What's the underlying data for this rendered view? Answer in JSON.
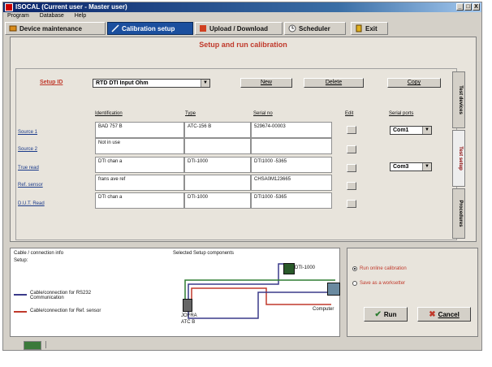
{
  "window": {
    "title": "ISOCAL (Current user - Master user)",
    "buttons": [
      "_",
      "□",
      "X"
    ]
  },
  "menu": [
    "Program",
    "Database",
    "Help"
  ],
  "toolbar": [
    {
      "label": "Device maintenance",
      "icon": "device-icon"
    },
    {
      "label": "Calibration setup",
      "icon": "setup-icon",
      "active": true
    },
    {
      "label": "Upload / Download",
      "icon": "upload-download-icon"
    },
    {
      "label": "Scheduler",
      "icon": "clock-icon"
    },
    {
      "label": "Exit",
      "icon": "exit-icon"
    }
  ],
  "main": {
    "heading": "Setup and run calibration",
    "setup_label": "Setup ID",
    "setup_value": "RTD DTI Input Ohm",
    "buttons": {
      "new": "New",
      "delete": "Delete",
      "copy": "Copy"
    },
    "columns": {
      "identification": "Identification",
      "type": "Type",
      "serial": "Serial no",
      "edit": "Edit",
      "serial_ports": "Serial ports"
    },
    "rows": [
      {
        "label": "Source 1",
        "id": "BAD 757 B",
        "type": "ATC-156 B",
        "serial": "529674-00003",
        "port": "Com1"
      },
      {
        "label": "Source 2",
        "id": "Not in use",
        "type": "",
        "serial": "",
        "port": ""
      },
      {
        "label": "True read",
        "id": "DTI chan a",
        "type": "DTI-1000",
        "serial": "DTI1000 -5365",
        "port": "Com3"
      },
      {
        "label": "Ref. sensor",
        "id": "frans ave ref",
        "type": "",
        "serial": "CHSA0M123665",
        "port": ""
      },
      {
        "label": "D.U.T. Read",
        "id": "DTI chan a",
        "type": "DTI-1000",
        "serial": "DTI1000 -5365",
        "port": ""
      }
    ]
  },
  "vertical_tabs": [
    "Test devices",
    "Test setup",
    "Procedures"
  ],
  "bottom": {
    "info_title": "Cable / connection info",
    "info_sub": "Setup:",
    "selected_title": "Selected Setup components",
    "legend": [
      {
        "text": "Cable/connection for RS232 Communication",
        "color": "#3a3a8a"
      },
      {
        "text": "Cable/connection for Ref. sensor",
        "color": "#c0392b"
      }
    ],
    "components": {
      "dti": "DTI-1000",
      "jofra": "JOFRA",
      "jofra2": "ATC B",
      "computer": "Computer"
    }
  },
  "run_panel": {
    "options": [
      {
        "label": "Run online calibration",
        "selected": true
      },
      {
        "label": "Save as a worksetter",
        "selected": false
      }
    ],
    "run": "Run",
    "cancel": "Cancel"
  }
}
